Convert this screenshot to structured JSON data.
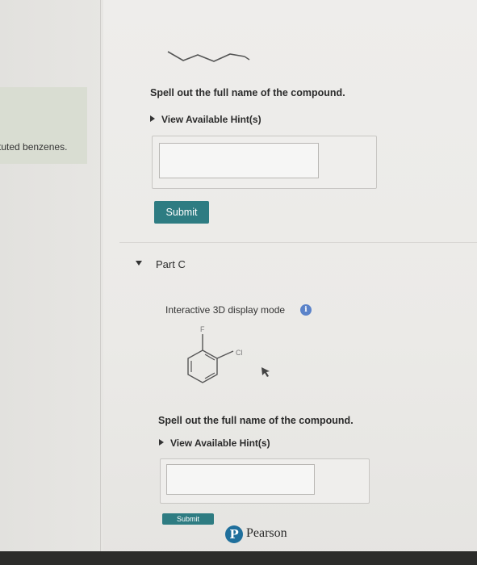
{
  "left_panel": {
    "text": "tuted benzenes."
  },
  "part_b": {
    "question": "Spell out the full name of the compound.",
    "hint_label": "View Available Hint(s)",
    "answer_value": "",
    "submit_label": "Submit"
  },
  "part_c": {
    "label": "Part C",
    "display_mode": "Interactive 3D display mode",
    "info_icon_glyph": "i",
    "atom_f": "F",
    "atom_cl": "Cl",
    "question": "Spell out the full name of the compound.",
    "hint_label": "View Available Hint(s)",
    "answer_value": "",
    "submit_label": "Submit"
  },
  "footer": {
    "brand": "Pearson",
    "logo_glyph": "P"
  },
  "colors": {
    "submit": "#2e7c82",
    "info": "#5b83c9",
    "pearson": "#1f6f9c"
  }
}
